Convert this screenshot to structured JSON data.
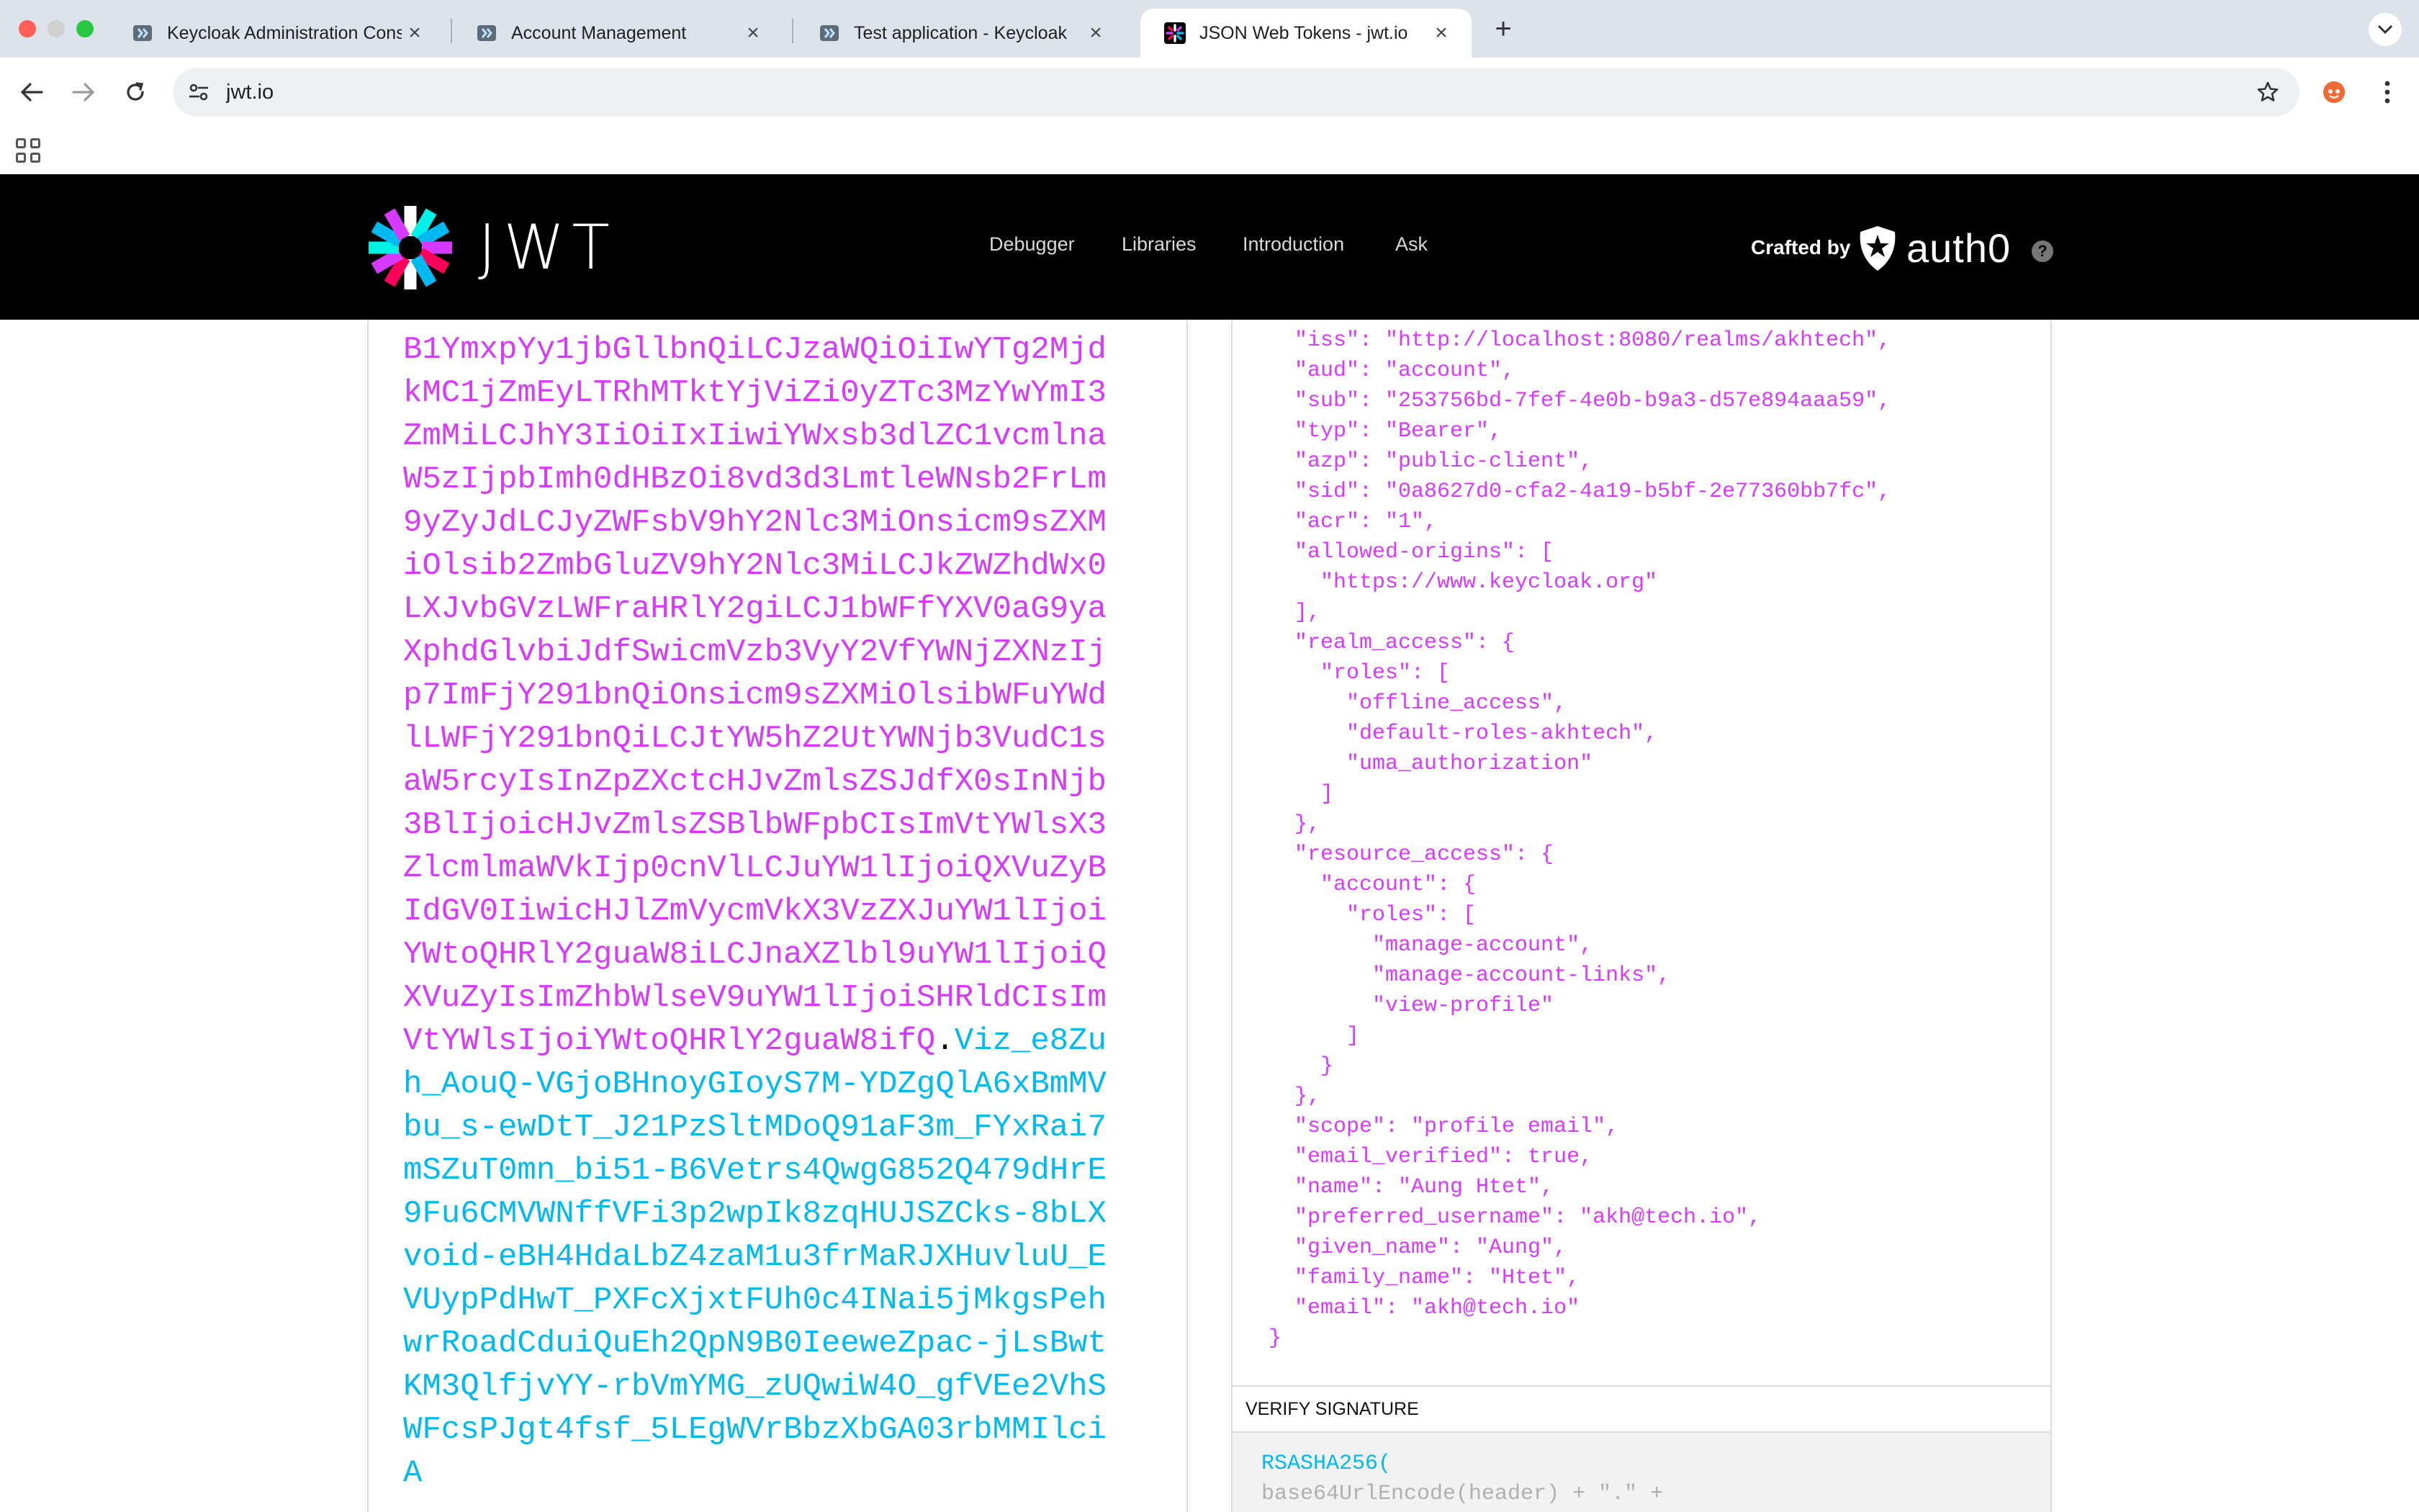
{
  "browser": {
    "tabs": [
      {
        "title": "Keycloak Administration Console"
      },
      {
        "title": "Account Management"
      },
      {
        "title": "Test application - Keycloak"
      },
      {
        "title": "JSON Web Tokens - jwt.io"
      }
    ],
    "url": "jwt.io"
  },
  "site": {
    "logo_text": "JWT",
    "nav": [
      "Debugger",
      "Libraries",
      "Introduction",
      "Ask"
    ],
    "crafted_by": "Crafted by",
    "partner": "auth0",
    "help": "?"
  },
  "encoded": {
    "payload_part": "B1YmxpYy1jbGllbnQiLCJzaWQiOiIwYTg2MjdkMC1jZmEyLTRhMTktYjViZi0yZTc3MzYwYmI3ZmMiLCJhY3IiOiIxIiwiYWxsb3dlZC1vcmlnaW5zIjpbImh0dHBzOi8vd3d3LmtleWNsb2FrLm9yZyJdLCJyZWFsbV9hY2Nlc3MiOnsicm9sZXMiOlsib2ZmbGluZV9hY2Nlc3MiLCJkZWZhdWx0LXJvbGVzLWFraHRlY2giLCJ1bWFfYXV0aG9yaXphdGlvbiJdfSwicmVzb3VyY2VfYWNjZXNzIjp7ImFjY291bnQiOnsicm9sZXMiOlsibWFuYWdlLWFjY291bnQiLCJtYW5hZ2UtYWNjb3VudC1saW5rcyIsInZpZXctcHJvZmlsZSJdfX0sInNjb3BlIjoicHJvZmlsZSBlbWFpbCIsImVtYWlsX3ZlcmlmaWVkIjp0cnVlLCJuYW1lIjoiQXVuZyBIdGV0IiwicHJlZmVycmVkX3VzZXJuYW1lIjoiYWtoQHRlY2guaW8iLCJnaXZlbl9uYW1lIjoiQXVuZyIsImZhbWlseV9uYW1lIjoiSHRldCIsImVtYWlsIjoiYWtoQHRlY2guaW8ifQ",
    "dot": ".",
    "signature_part": "Viz_e8Zuh_AouQ-VGjoBHnoyGIoyS7M-YDZgQlA6xBmMVbu_s-ewDtT_J21PzSltMDoQ91aF3m_FYxRai7mSZuT0mn_bi51-B6Vetrs4QwgG852Q479dHrE9Fu6CMVWNffVFi3p2wpIk8zqHUJSZCks-8bLXvoid-eBH4HdaLbZ4zaM1u3frMaRJXHuvluU_EVUypPdHwT_PXFcXjxtFUh0c4INai5jMkgsPehwrRoadCduiQuEh2QpN9B0IeeweZpac-jLsBwtKM3QlfjvYY-rbVmYMG_zUQwiW4O_gfVEe2VhSWFcsPJgt4fsf_5LEgWVrBbzXbGA03rbMMIlciA"
  },
  "decoded": {
    "payload_lines": [
      "  \"iss\": \"http://localhost:8080/realms/akhtech\",",
      "  \"aud\": \"account\",",
      "  \"sub\": \"253756bd-7fef-4e0b-b9a3-d57e894aaa59\",",
      "  \"typ\": \"Bearer\",",
      "  \"azp\": \"public-client\",",
      "  \"sid\": \"0a8627d0-cfa2-4a19-b5bf-2e77360bb7fc\",",
      "  \"acr\": \"1\",",
      "  \"allowed-origins\": [",
      "    \"https://www.keycloak.org\"",
      "  ],",
      "  \"realm_access\": {",
      "    \"roles\": [",
      "      \"offline_access\",",
      "      \"default-roles-akhtech\",",
      "      \"uma_authorization\"",
      "    ]",
      "  },",
      "  \"resource_access\": {",
      "    \"account\": {",
      "      \"roles\": [",
      "        \"manage-account\",",
      "        \"manage-account-links\",",
      "        \"view-profile\"",
      "      ]",
      "    }",
      "  },",
      "  \"scope\": \"profile email\",",
      "  \"email_verified\": true,",
      "  \"name\": \"Aung Htet\",",
      "  \"preferred_username\": \"akh@tech.io\",",
      "  \"given_name\": \"Aung\",",
      "  \"family_name\": \"Htet\",",
      "  \"email\": \"akh@tech.io\"",
      "}"
    ],
    "verify_title": "VERIFY SIGNATURE",
    "verify_algo": "RSASHA256(",
    "verify_line2": "  base64UrlEncode(header) + \".\" +"
  },
  "colors": {
    "payload": "#d63aff",
    "signature": "#00b9f1",
    "header_bg": "#000000"
  }
}
